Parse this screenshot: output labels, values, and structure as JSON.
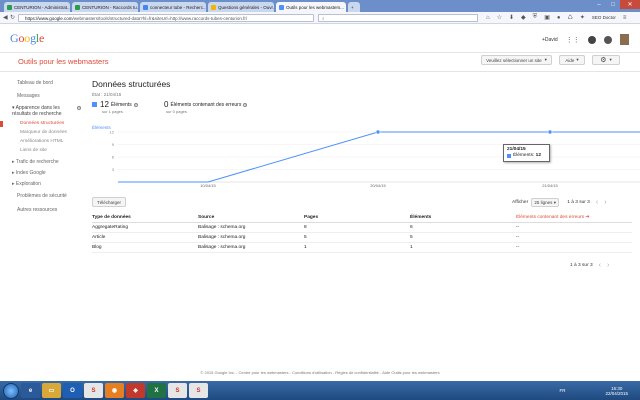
{
  "browser": {
    "tabs": [
      {
        "label": "CENTURION - Administrat...",
        "color": "#2a9d4b",
        "active": false
      },
      {
        "label": "CENTURION - Raccords tu...",
        "color": "#2a9d4b",
        "active": false
      },
      {
        "label": "connecteur tube - Recherc...",
        "color": "#4285f4",
        "active": false
      },
      {
        "label": "Questions générales - Ouvr...",
        "color": "#f4b400",
        "active": false
      },
      {
        "label": "Outils pour les webmasters...",
        "color": "#4d90fe",
        "active": true
      }
    ],
    "url_host": "https://www.google.com",
    "url_path": "/webmasters/tools/structured-data?hl=fr&siteUrl=http://www.raccords-tubes-centurion.fr/",
    "search_placeholder": "",
    "user_label": "SEO Doctor"
  },
  "google": {
    "user": "+David",
    "wmt_title": "Outils pour les webmasters",
    "site_select": "Veuillez sélectionner un site",
    "help_label": "Aide"
  },
  "sidebar": {
    "items": [
      {
        "label": "Tableau de bord"
      },
      {
        "label": "Messages"
      },
      {
        "label": "Apparence dans les résultats de recherche"
      },
      {
        "label": "Trafic de recherche"
      },
      {
        "label": "Index Google"
      },
      {
        "label": "Exploration"
      },
      {
        "label": "Problèmes de sécurité"
      },
      {
        "label": "Autres ressources"
      }
    ],
    "subitems": [
      {
        "label": "Données structurées"
      },
      {
        "label": "Marqueur de données"
      },
      {
        "label": "Améliorations HTML"
      },
      {
        "label": "Liens de site"
      }
    ]
  },
  "main": {
    "title": "Données structurées",
    "etat": "État : 21/04/15",
    "stat1": {
      "num": "12",
      "label": "Éléments",
      "sub": "sur 1 pages"
    },
    "stat2": {
      "num": "0",
      "label": "Éléments contenant des erreurs",
      "sub": "sur 0 pages"
    },
    "download": "Télécharger",
    "show_label": "Afficher",
    "rows_select": "25 lignes",
    "pager": "1 à 3 sur 3",
    "tooltip_date": "21/04/15",
    "tooltip_value": "12",
    "table": {
      "headers": [
        "Type de données",
        "Source",
        "Pages",
        "Éléments",
        "Éléments contenant des erreurs"
      ],
      "rows": [
        [
          "AggregateRating",
          "Balisage : schema.org",
          "8",
          "6",
          "--"
        ],
        [
          "Article",
          "Balisage : schema.org",
          "5",
          "5",
          "--"
        ],
        [
          "Blog",
          "Balisage : schema.org",
          "1",
          "1",
          "--"
        ]
      ]
    }
  },
  "chart_data": {
    "type": "line",
    "series": [
      {
        "name": "Éléments",
        "values": [
          0,
          12,
          12
        ]
      }
    ],
    "x": [
      "10/04/15",
      "20/04/15",
      "21/04/15"
    ],
    "y_ticks": [
      "12",
      "9",
      "6",
      "3"
    ],
    "ylim": [
      0,
      12
    ],
    "color": "#4d90fe"
  },
  "footer": "© 2015 Google Inc. - Centre pour les webmasters - Conditions d'utilisation - Règles de confidentialité - Aide Outils pour les webmasters",
  "taskbar": {
    "time": "15:30",
    "date": "22/04/2015",
    "lang": "FR"
  }
}
